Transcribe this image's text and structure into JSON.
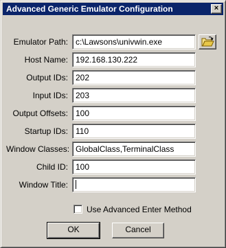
{
  "window": {
    "title": "Advanced Generic Emulator Configuration",
    "close_glyph": "×"
  },
  "fields": [
    {
      "label": "Emulator Path:",
      "value": "c:\\Lawsons\\univwin.exe"
    },
    {
      "label": "Host Name:",
      "value": "192.168.130.222"
    },
    {
      "label": "Output IDs:",
      "value": "202"
    },
    {
      "label": "Input IDs:",
      "value": "203"
    },
    {
      "label": "Output Offsets:",
      "value": "100"
    },
    {
      "label": "Startup IDs:",
      "value": "110"
    },
    {
      "label": "Window Classes:",
      "value": "GlobalClass,TerminalClass"
    },
    {
      "label": "Child ID:",
      "value": "100"
    },
    {
      "label": "Window Title:",
      "value": ""
    }
  ],
  "browse": {
    "icon": "open-folder-icon"
  },
  "advanced_enter": {
    "label": "Use Advanced Enter Method",
    "checked": false
  },
  "buttons": {
    "ok": "OK",
    "cancel": "Cancel"
  }
}
